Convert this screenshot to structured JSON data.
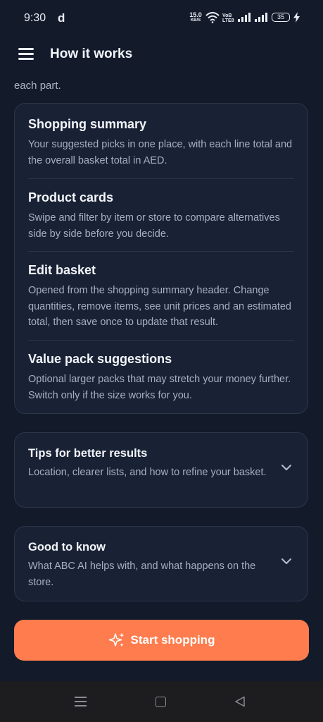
{
  "status_bar": {
    "time": "9:30",
    "notification_letter": "d",
    "net_speed_value": "15.0",
    "net_speed_unit": "KB/S",
    "volte_top": "VoB",
    "volte_bottom": "LTE8",
    "battery": "35"
  },
  "app_bar": {
    "title": "How it works"
  },
  "intro_tail": "each part.",
  "sections": [
    {
      "title": "Shopping summary",
      "body": "Your suggested picks in one place, with each line total and the overall basket total in AED."
    },
    {
      "title": "Product cards",
      "body": "Swipe and filter by item or store to compare alternatives side by side before you decide."
    },
    {
      "title": "Edit basket",
      "body": "Opened from the shopping summary header. Change quantities, remove items, see unit prices and an estimated total, then save once to update that result."
    },
    {
      "title": "Value pack suggestions",
      "body": "Optional larger packs that may stretch your money further. Switch only if the size works for you."
    }
  ],
  "accordions": [
    {
      "title": "Tips for better results",
      "subtitle": "Location, clearer lists, and how to refine your basket.",
      "icon": "chevron-down-icon"
    },
    {
      "title": "Good to know",
      "subtitle": "What ABC AI helps with, and what happens on the store.",
      "icon": "chevron-down-icon"
    }
  ],
  "cta": {
    "label": "Start shopping",
    "icon": "sparkles-icon"
  },
  "colors": {
    "background": "#131b2b",
    "card": "#192235",
    "accent": "#fe7c4d"
  }
}
